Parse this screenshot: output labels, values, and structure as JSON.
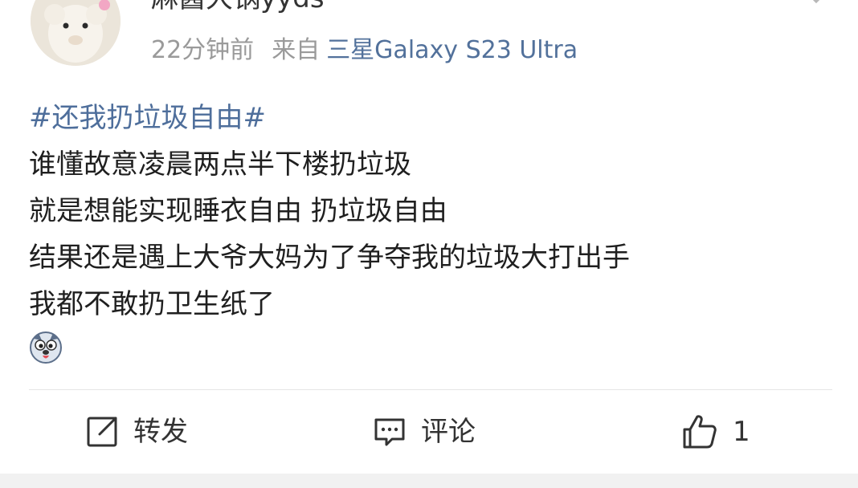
{
  "post": {
    "author": {
      "name": "麻酱大锅yyds"
    },
    "time": "22分钟前",
    "source_label": "来自",
    "device": "三星Galaxy S23 Ultra",
    "topic": "#还我扔垃圾自由#",
    "lines": [
      "谁懂故意凌晨两点半下楼扔垃圾",
      "就是想能实现睡衣自由 扔垃圾自由",
      "结果还是遇上大爷大妈为了争夺我的垃圾大打出手",
      "我都不敢扔卫生纸了"
    ],
    "emoji_icon": "husky-face-icon"
  },
  "actions": {
    "repost": {
      "label": "转发",
      "icon": "share-icon"
    },
    "comment": {
      "label": "评论",
      "icon": "comment-icon"
    },
    "like": {
      "count": "1",
      "icon": "thumbs-up-icon"
    }
  },
  "colors": {
    "link_blue": "#4e6e9b",
    "meta_gray": "#9a9a9a",
    "text": "#1f1f1f"
  }
}
